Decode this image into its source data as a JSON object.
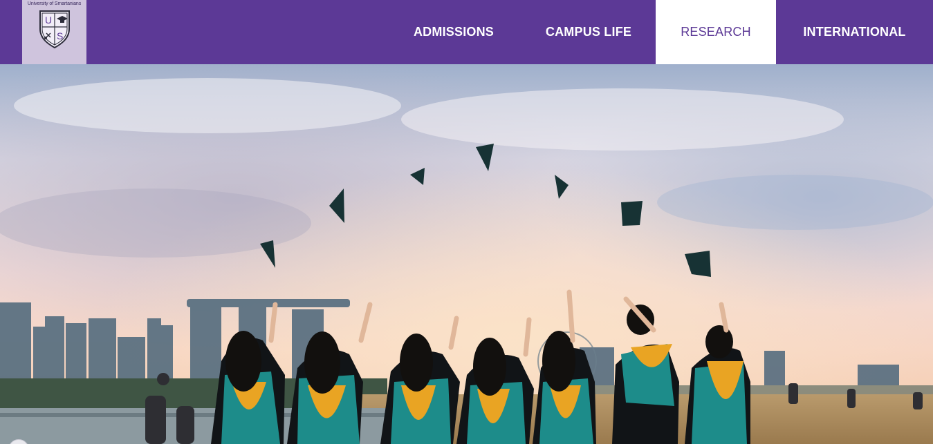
{
  "header": {
    "background": "#5c3996",
    "logo": {
      "text": "University of Smartanians",
      "crest_letters": [
        "U",
        "S"
      ],
      "icon": "crest-shield-icon"
    },
    "nav": [
      {
        "label": "ADMISSIONS",
        "active": false
      },
      {
        "label": "CAMPUS LIFE",
        "active": false
      },
      {
        "label": "RESEARCH",
        "active": true
      },
      {
        "label": "INTERNATIONAL",
        "active": false
      }
    ]
  },
  "hero": {
    "image": "graduates-throwing-caps-photo"
  }
}
